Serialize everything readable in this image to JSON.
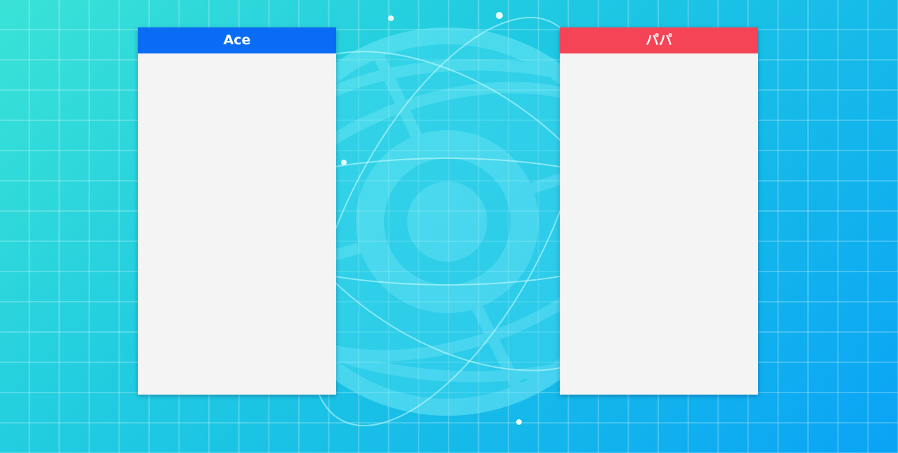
{
  "colors": {
    "background_start": "#3ae3d6",
    "background_end": "#0aa3f6",
    "emblem": "#5ce4f2",
    "panel_body": "#f4f4f4"
  },
  "background": {
    "emblem_icon": "globe-orbit-emblem-icon"
  },
  "players": [
    {
      "name": "Ace",
      "color": "#0a6cf5"
    },
    {
      "name": "パパ",
      "color": "#f44456"
    }
  ]
}
